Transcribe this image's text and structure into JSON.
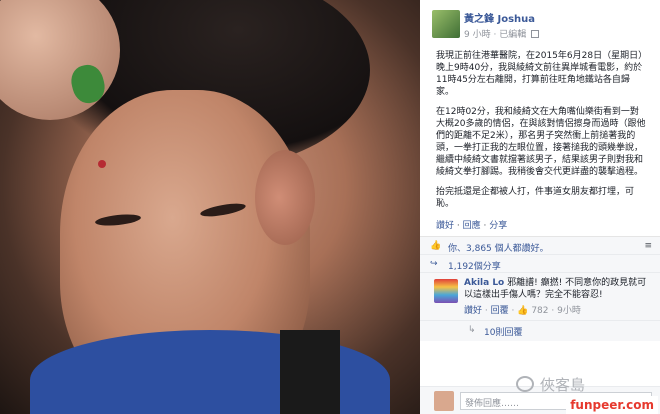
{
  "post": {
    "author": "黃之鋒 Joshua",
    "time": "9 小時",
    "edited": "已編輯",
    "paragraphs": [
      "我現正前往港華醫院，在2015年6月28日（星期日）晚上9時40分，我與綾綺文前往異岸城看電影，約於11時45分左右離開，打算前往旺角地鐵站各自歸家。",
      "在12時02分，我和綾綺文在大角嘴仙樂街看到一對大概20多歲的情侶，在與該對情侶擦身而過時（跟他們的距離不足2米），那名男子突然衝上前搥著我的頭，一拳打正我的左眼位置，接著搥我的頭幾拳說，繼續中綾綺文書就擋著該男子，結果該男子則對我和綾綺文拳打腳踢。我稍後會交代更詳盡的襲擊過程。",
      "抬完抵還是企都被人打，件事道女朋友都打埋，可恥。"
    ],
    "actions": {
      "like": "讚好",
      "comment": "回應",
      "share": "分享"
    },
    "likes_summary": "你、3,865 個人都讚好。",
    "shares_summary": "1,192個分享",
    "comment": {
      "name": "Akila Lo",
      "text": "邪離譜! 癲撚! 不同意你的政見就可以這樣出手傷人嗎？完全不能容忍!",
      "reply": "回覆",
      "like": "讚好",
      "like_count": "782",
      "time": "9小時"
    },
    "replies_label": "10則回覆",
    "composer_placeholder": "發佈回應……"
  },
  "watermark": {
    "cn": "俠客島",
    "site": "funpeer.com"
  },
  "colors": {
    "link": "#3b5998",
    "site_red": "#e6392e",
    "shirt_blue": "#2d4fa0",
    "nail_green": "#3d8a3a"
  }
}
